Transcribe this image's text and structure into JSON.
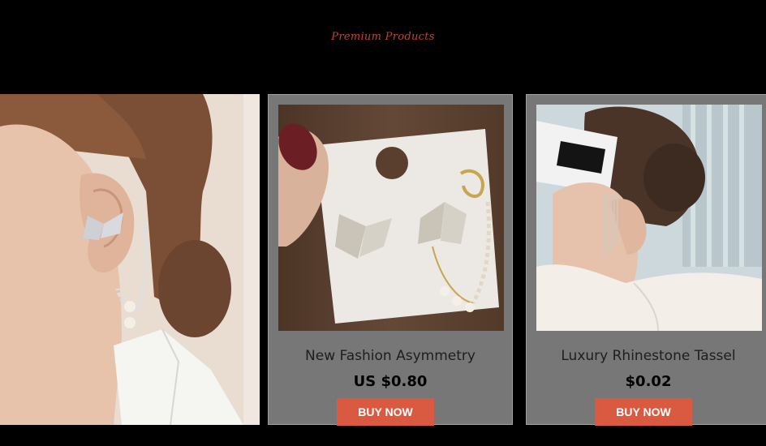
{
  "header": {
    "title": "Premium Products"
  },
  "products": [
    {
      "name": "New Fashion Asymmetry",
      "price": "US $0.80",
      "button_label": "BUY NOW"
    },
    {
      "name": "Luxury Rhinestone Tassel",
      "price": "$0.02",
      "button_label": "BUY NOW"
    }
  ],
  "colors": {
    "background": "#000000",
    "title": "#c0443a",
    "card": "#777777",
    "button": "#d95a40"
  }
}
